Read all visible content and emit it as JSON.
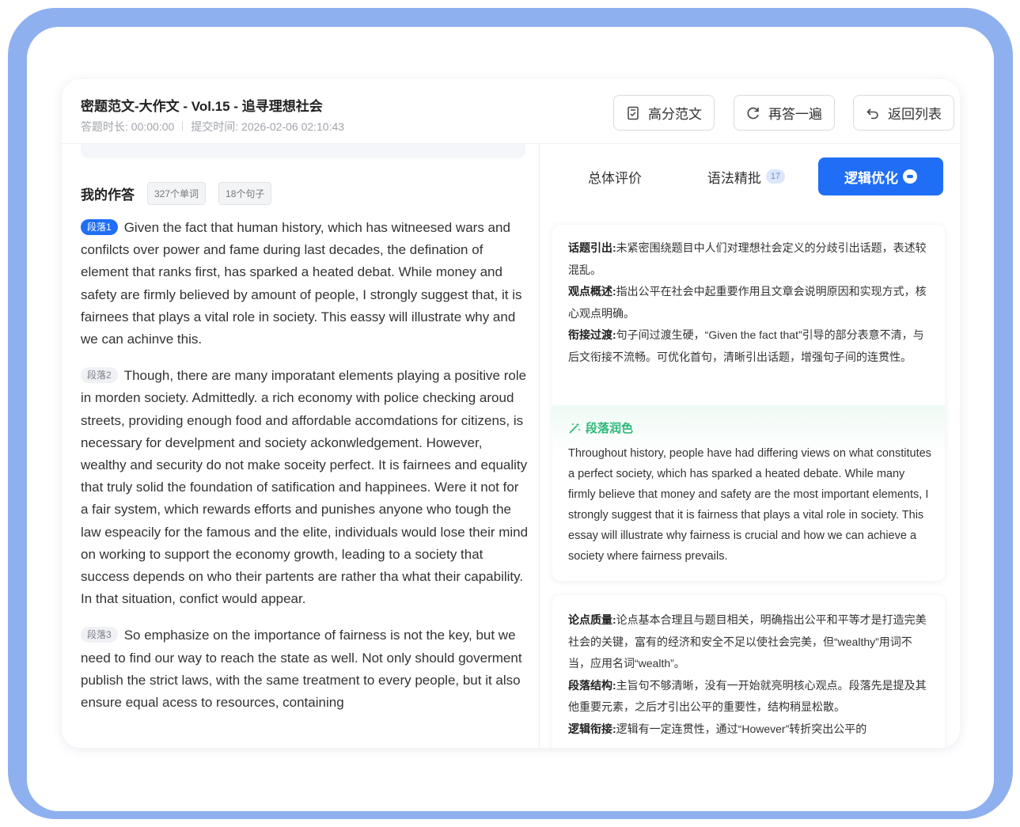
{
  "header": {
    "title": "密题范文-大作文 - Vol.15 - 追寻理想社会",
    "duration": "答题时长: 00:00:00",
    "submit_time": "提交时间: 2026-02-06 02:10:43",
    "buttons": {
      "model_essay": "高分范文",
      "retry": "再答一遍",
      "back": "返回列表"
    }
  },
  "answer": {
    "label": "我的作答",
    "word_count": "327个单词",
    "sentence_count": "18个句子",
    "paragraphs": [
      {
        "badge": "段落1",
        "text": "Given the fact that human history, which has witneesed wars and confilcts over power and fame during last decades, the defination of element that ranks first, has sparked a heated debat. While money and safety are firmly believed by amount of people, I strongly suggest that, it is fairnees that plays a vital role in society. This eassy will illustrate why and we can achinve this."
      },
      {
        "badge": "段落2",
        "text": "Though, there are many imporatant elements playing a positive role in morden society. Admittedly. a rich economy with police checking aroud streets, providing enough food and affordable accomdations for citizens, is necessary for develpment and society ackonwledgement. However, wealthy and security do not make soceity perfect. It is fairnees and equality that truly solid the foundation of satification and happinees. Were it not for a fair system, which rewards efforts and punishes anyone who tough the law espeacily for the famous and the elite, individuals would lose their mind on working to support the economy growth, leading to a society that success depends on who their partents are rather tha what their capability. In that situation, confict would appear."
      },
      {
        "badge": "段落3",
        "text": "So emphasize on the importance of fairness is not the key, but we need to find our way to reach the state as well. Not only should goverment publish the strict laws, with the same treatment to every people, but it also ensure equal acess to resources, containing"
      }
    ]
  },
  "tabs": {
    "overall": "总体评价",
    "grammar": "语法精批",
    "grammar_count": "17",
    "logic": "逻辑优化"
  },
  "logic_panel": {
    "items": [
      {
        "label": "话题引出:",
        "text": "未紧密围绕题目中人们对理想社会定义的分歧引出话题，表述较混乱。"
      },
      {
        "label": "观点概述:",
        "text": "指出公平在社会中起重要作用且文章会说明原因和实现方式，核心观点明确。"
      },
      {
        "label": "衔接过渡:",
        "text": "句子间过渡生硬，“Given the fact that”引导的部分表意不清，与后文衔接不流畅。可优化首句，清晰引出话题，增强句子间的连贯性。"
      }
    ],
    "polish_title": "段落润色",
    "polish_text": "Throughout history, people have had differing views on what constitutes a perfect society, which has sparked a heated debate. While many firmly believe that money and safety are the most important elements, I strongly suggest that it is fairness that plays a vital role in society. This essay will illustrate why fairness is crucial and how we can achieve a society where fairness prevails."
  },
  "logic_panel2": {
    "items": [
      {
        "label": "论点质量:",
        "text": "论点基本合理且与题目相关，明确指出公平和平等才是打造完美社会的关键，富有的经济和安全不足以使社会完美，但“wealthy”用词不当，应用名词“wealth”。"
      },
      {
        "label": "段落结构:",
        "text": "主旨句不够清晰，没有一开始就亮明核心观点。段落先是提及其他重要元素，之后才引出公平的重要性，结构稍显松散。"
      },
      {
        "label": "逻辑衔接:",
        "text": "逻辑有一定连贯性，通过“However”转折突出公平的"
      }
    ]
  },
  "colors": {
    "accent": "#1f6ef5",
    "frame": "#8fb0ef",
    "polish_green": "#2eb87a",
    "error_underline": "#e5484d"
  },
  "icons": [
    "document-icon",
    "refresh-icon",
    "return-icon",
    "magic-wand-icon"
  ]
}
